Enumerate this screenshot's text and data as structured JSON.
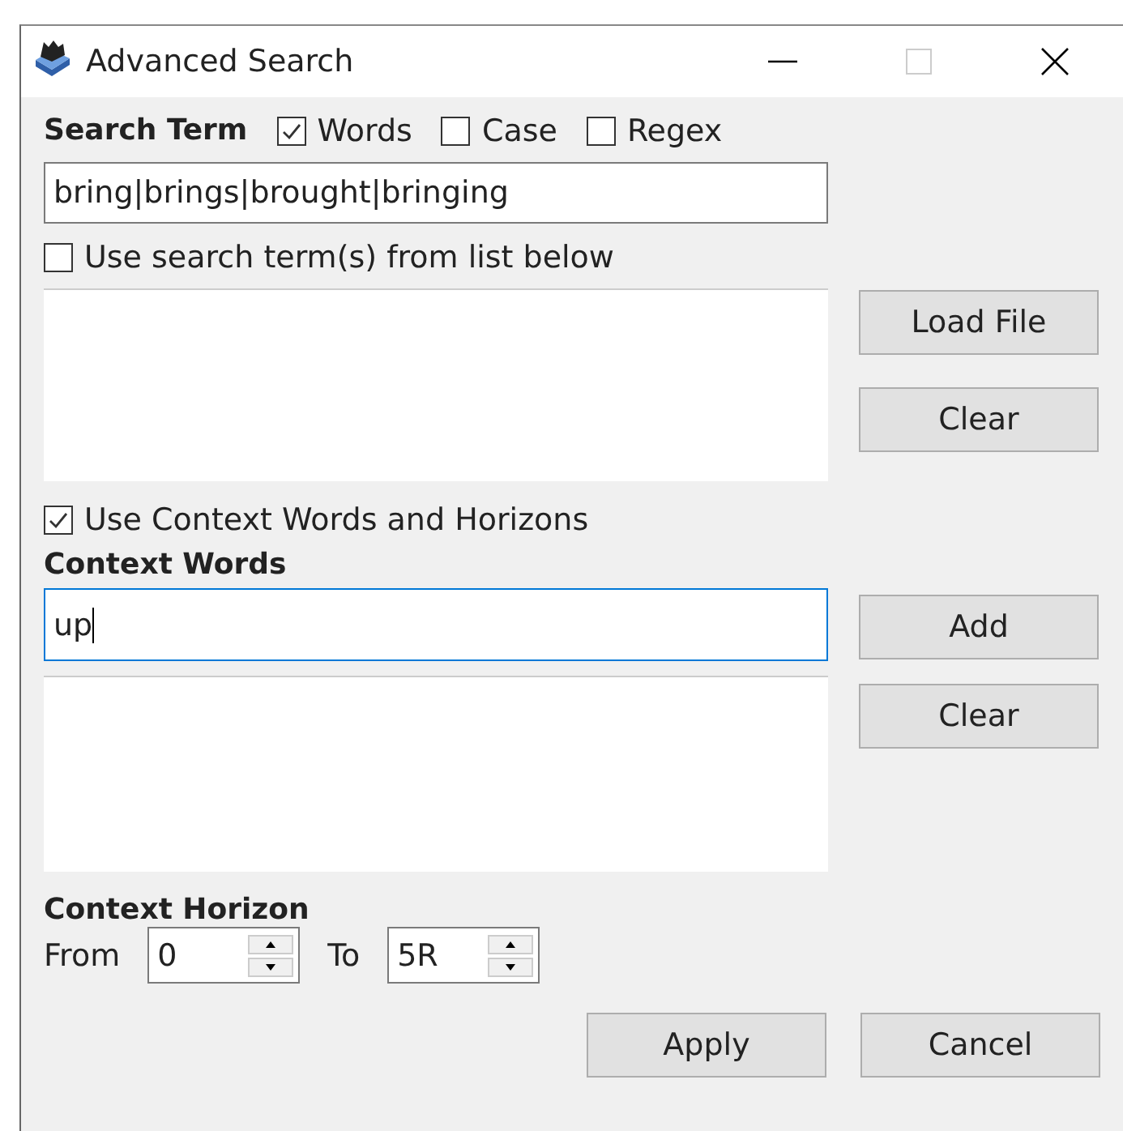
{
  "window": {
    "title": "Advanced Search"
  },
  "search_term": {
    "label": "Search Term",
    "options": [
      {
        "label": "Words",
        "checked": true
      },
      {
        "label": "Case",
        "checked": false
      },
      {
        "label": "Regex",
        "checked": false
      }
    ],
    "value": "bring|brings|brought|bringing"
  },
  "use_list": {
    "label": "Use search term(s) from list below",
    "checked": false
  },
  "list_buttons": [
    "Load File",
    "Clear"
  ],
  "use_context": {
    "label": "Use Context Words and Horizons",
    "checked": true
  },
  "context_words": {
    "label": "Context Words",
    "value": "up",
    "focused": true
  },
  "context_buttons": [
    "Add",
    "Clear"
  ],
  "context_horizon": {
    "label": "Context Horizon",
    "from_label": "From",
    "from_value": "0",
    "to_label": "To",
    "to_value": "5R"
  },
  "buttons": [
    "Apply",
    "Cancel"
  ]
}
